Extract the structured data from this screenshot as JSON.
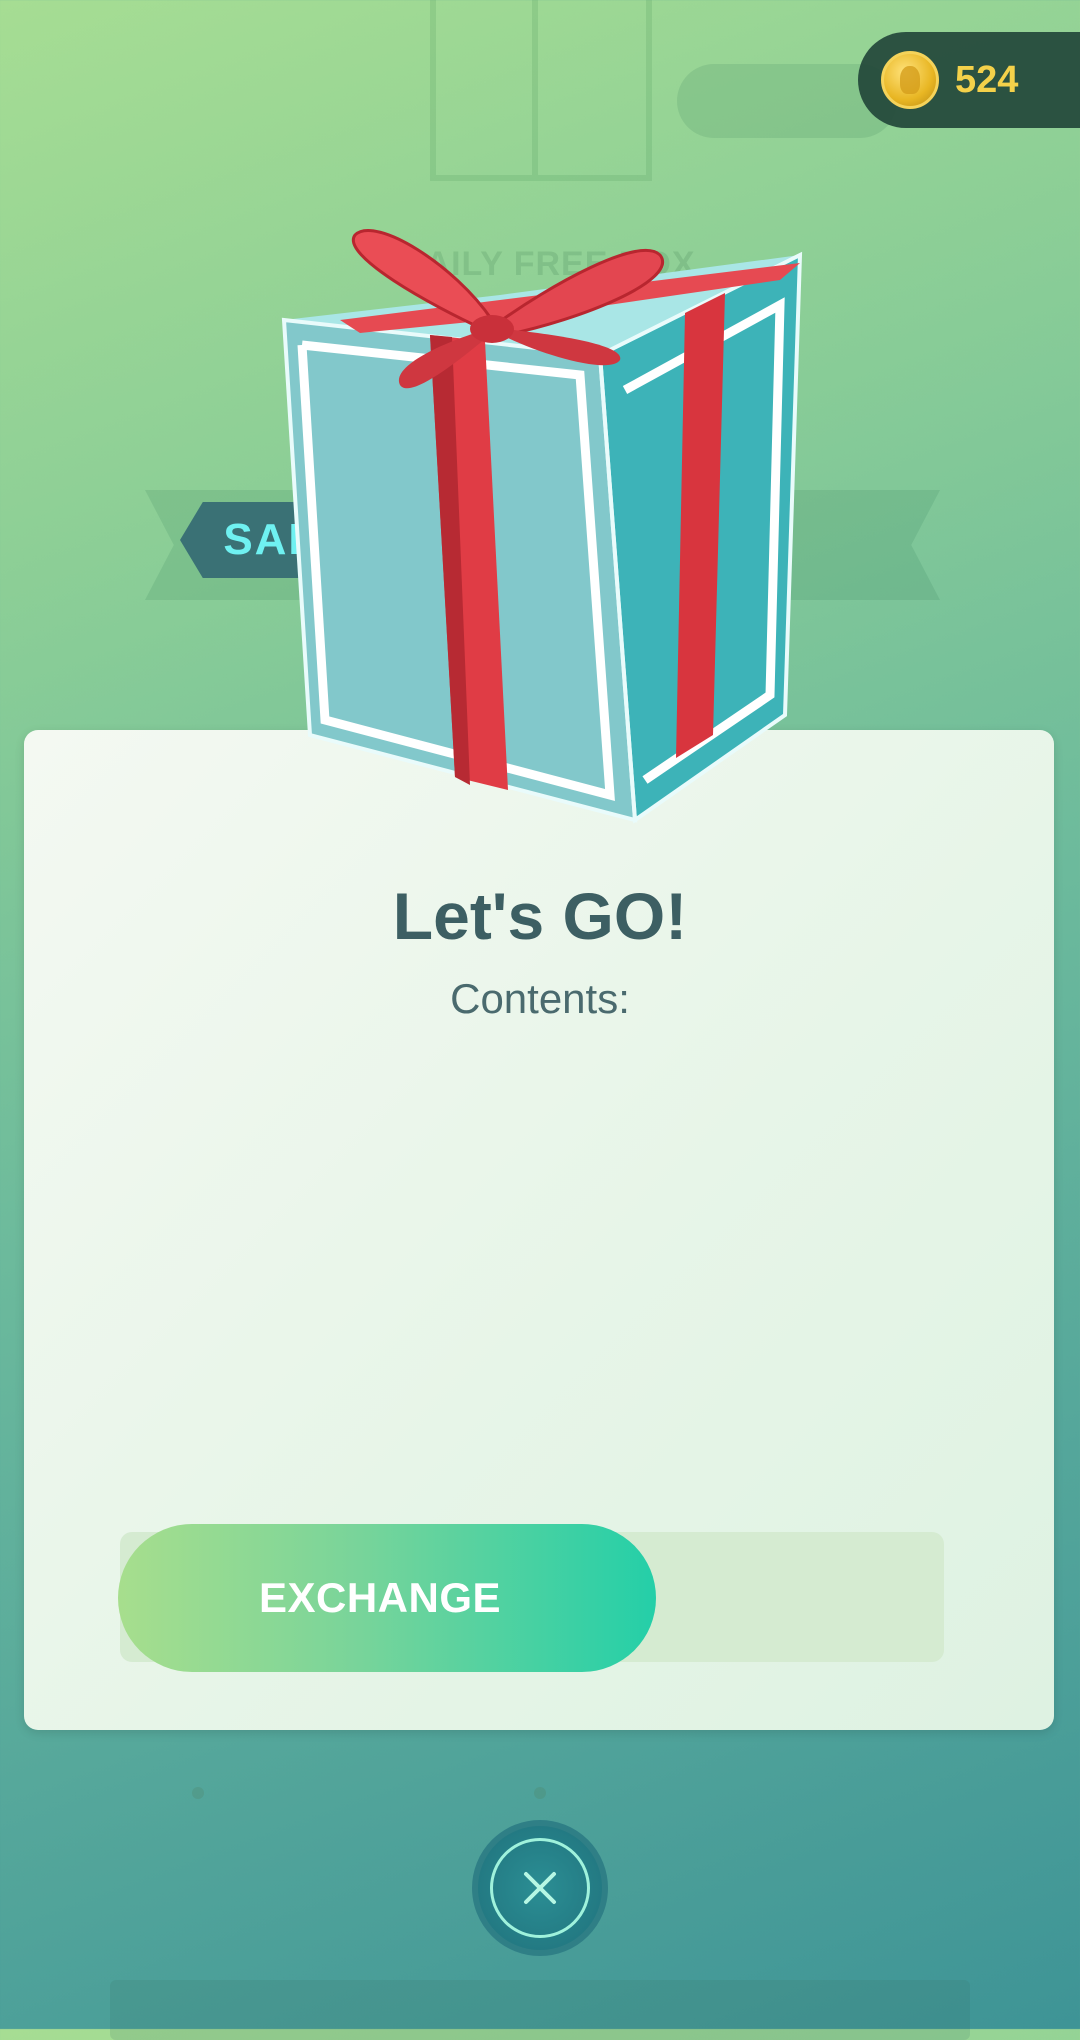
{
  "header": {
    "coins": "524"
  },
  "background": {
    "ghost_label": "DAILY FREE BOX"
  },
  "sale_badge": {
    "label": "SALE"
  },
  "offer": {
    "title": "Let's GO!",
    "contents_label": "Contents:",
    "exchange_label": "EXCHANGE"
  },
  "icons": {
    "coin": "pokecoin-icon",
    "gift": "gift-box-icon",
    "close": "close-icon"
  },
  "colors": {
    "coin_text": "#f4d14a",
    "sale_text": "#6ff1f1",
    "title": "#3d5f63",
    "exchange_start": "#a7de8d",
    "exchange_end": "#24cfa8",
    "ribbon": "#e03c45",
    "box": "#7fc9cc"
  }
}
